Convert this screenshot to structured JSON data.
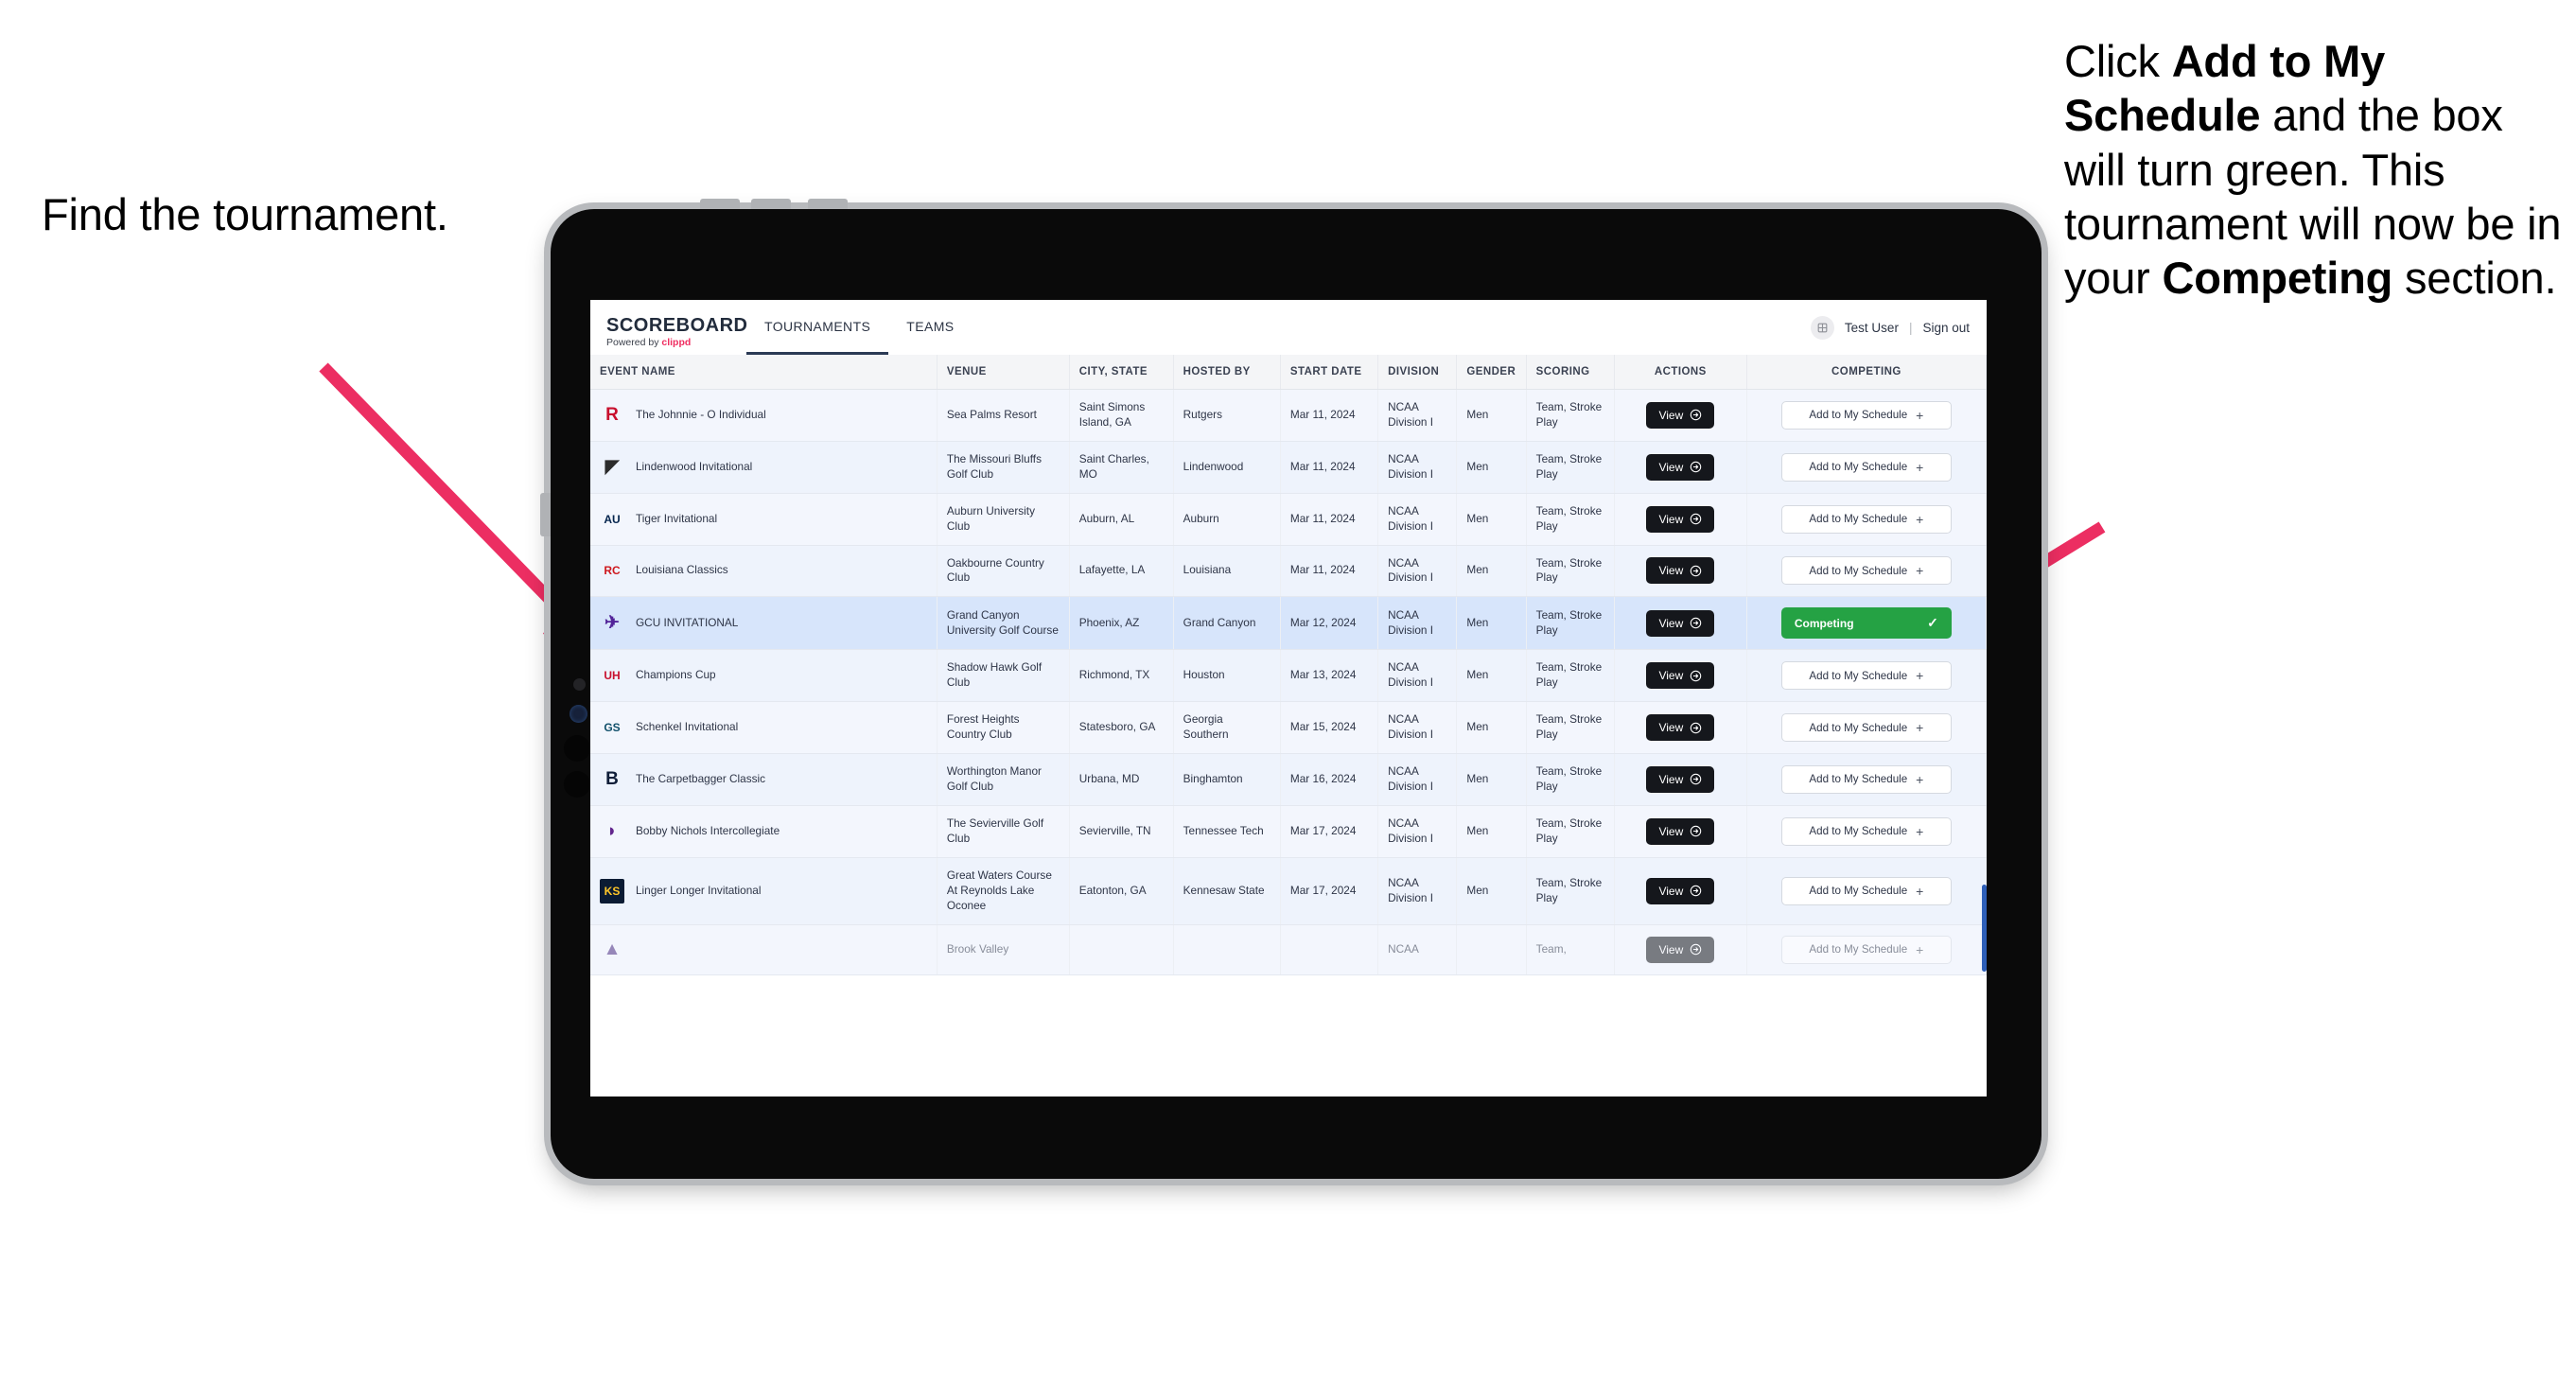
{
  "annotations": {
    "left": "Find the tournament.",
    "right_parts": [
      {
        "text": "Click ",
        "bold": false
      },
      {
        "text": "Add to My Schedule",
        "bold": true
      },
      {
        "text": " and the box will turn green. This tournament will now be in your ",
        "bold": false
      },
      {
        "text": "Competing",
        "bold": true
      },
      {
        "text": " section.",
        "bold": false
      }
    ],
    "arrow_color": "#ec2e62"
  },
  "app": {
    "brand": {
      "title": "SCOREBOARD",
      "powered_prefix": "Powered by ",
      "powered_brand": "clippd",
      "brand_color": "#ef2d60",
      "title_color": "#222c3c"
    },
    "nav": [
      {
        "label": "TOURNAMENTS",
        "active": true
      },
      {
        "label": "TEAMS",
        "active": false
      }
    ],
    "user": {
      "avatar_icon": "user-avatar-icon",
      "name": "Test User",
      "separator": "|",
      "signout": "Sign out"
    },
    "table": {
      "columns": [
        "EVENT NAME",
        "VENUE",
        "CITY, STATE",
        "HOSTED BY",
        "START DATE",
        "DIVISION",
        "GENDER",
        "SCORING",
        "ACTIONS",
        "COMPETING"
      ],
      "buttons": {
        "view": "View",
        "view_icon": "arrow-right-circle-icon",
        "add": "Add to My Schedule",
        "add_icon": "plus-icon",
        "competing": "Competing",
        "competing_icon": "check-icon",
        "competing_color": "#25a244"
      },
      "rows": [
        {
          "logo": "R",
          "logo_color": "#c8102e",
          "logo_bg": "transparent",
          "event": "The Johnnie - O Individual",
          "venue": "Sea Palms Resort",
          "city": "Saint Simons Island, GA",
          "host": "Rutgers",
          "date": "Mar 11, 2024",
          "division": "NCAA Division I",
          "gender": "Men",
          "scoring": "Team, Stroke Play",
          "competing": false
        },
        {
          "logo": "◤",
          "logo_color": "#2b2b2b",
          "logo_bg": "transparent",
          "event": "Lindenwood Invitational",
          "venue": "The Missouri Bluffs Golf Club",
          "city": "Saint Charles, MO",
          "host": "Lindenwood",
          "date": "Mar 11, 2024",
          "division": "NCAA Division I",
          "gender": "Men",
          "scoring": "Team, Stroke Play",
          "competing": false
        },
        {
          "logo": "AU",
          "logo_color": "#03244d",
          "logo_bg": "transparent",
          "event": "Tiger Invitational",
          "venue": "Auburn University Club",
          "city": "Auburn, AL",
          "host": "Auburn",
          "date": "Mar 11, 2024",
          "division": "NCAA Division I",
          "gender": "Men",
          "scoring": "Team, Stroke Play",
          "competing": false
        },
        {
          "logo": "RC",
          "logo_color": "#ce181e",
          "logo_bg": "transparent",
          "event": "Louisiana Classics",
          "venue": "Oakbourne Country Club",
          "city": "Lafayette, LA",
          "host": "Louisiana",
          "date": "Mar 11, 2024",
          "division": "NCAA Division I",
          "gender": "Men",
          "scoring": "Team, Stroke Play",
          "competing": false
        },
        {
          "logo": "✈",
          "logo_color": "#522398",
          "logo_bg": "transparent",
          "event": "GCU INVITATIONAL",
          "venue": "Grand Canyon University Golf Course",
          "city": "Phoenix, AZ",
          "host": "Grand Canyon",
          "date": "Mar 12, 2024",
          "division": "NCAA Division I",
          "gender": "Men",
          "scoring": "Team, Stroke Play",
          "competing": true,
          "selected": true
        },
        {
          "logo": "UH",
          "logo_color": "#c8102e",
          "logo_bg": "transparent",
          "event": "Champions Cup",
          "venue": "Shadow Hawk Golf Club",
          "city": "Richmond, TX",
          "host": "Houston",
          "date": "Mar 13, 2024",
          "division": "NCAA Division I",
          "gender": "Men",
          "scoring": "Team, Stroke Play",
          "competing": false
        },
        {
          "logo": "GS",
          "logo_color": "#11506b",
          "logo_bg": "transparent",
          "event": "Schenkel Invitational",
          "venue": "Forest Heights Country Club",
          "city": "Statesboro, GA",
          "host": "Georgia Southern",
          "date": "Mar 15, 2024",
          "division": "NCAA Division I",
          "gender": "Men",
          "scoring": "Team, Stroke Play",
          "competing": false
        },
        {
          "logo": "B",
          "logo_color": "#0f1e38",
          "logo_bg": "transparent",
          "event": "The Carpetbagger Classic",
          "venue": "Worthington Manor Golf Club",
          "city": "Urbana, MD",
          "host": "Binghamton",
          "date": "Mar 16, 2024",
          "division": "NCAA Division I",
          "gender": "Men",
          "scoring": "Team, Stroke Play",
          "competing": false
        },
        {
          "logo": "◗",
          "logo_color": "#62268d",
          "logo_bg": "transparent",
          "event": "Bobby Nichols Intercollegiate",
          "venue": "The Sevierville Golf Club",
          "city": "Sevierville, TN",
          "host": "Tennessee Tech",
          "date": "Mar 17, 2024",
          "division": "NCAA Division I",
          "gender": "Men",
          "scoring": "Team, Stroke Play",
          "competing": false
        },
        {
          "logo": "KS",
          "logo_color": "#ffc629",
          "logo_bg": "#0b1b33",
          "event": "Linger Longer Invitational",
          "venue": "Great Waters Course At Reynolds Lake Oconee",
          "city": "Eatonton, GA",
          "host": "Kennesaw State",
          "date": "Mar 17, 2024",
          "division": "NCAA Division I",
          "gender": "Men",
          "scoring": "Team, Stroke Play",
          "competing": false
        },
        {
          "logo": "▲",
          "logo_color": "#4b2e83",
          "logo_bg": "transparent",
          "event": "",
          "venue": "Brook Valley",
          "city": "",
          "host": "",
          "date": "",
          "division": "NCAA",
          "gender": "",
          "scoring": "Team,",
          "competing": false,
          "clipped": true
        }
      ]
    }
  }
}
